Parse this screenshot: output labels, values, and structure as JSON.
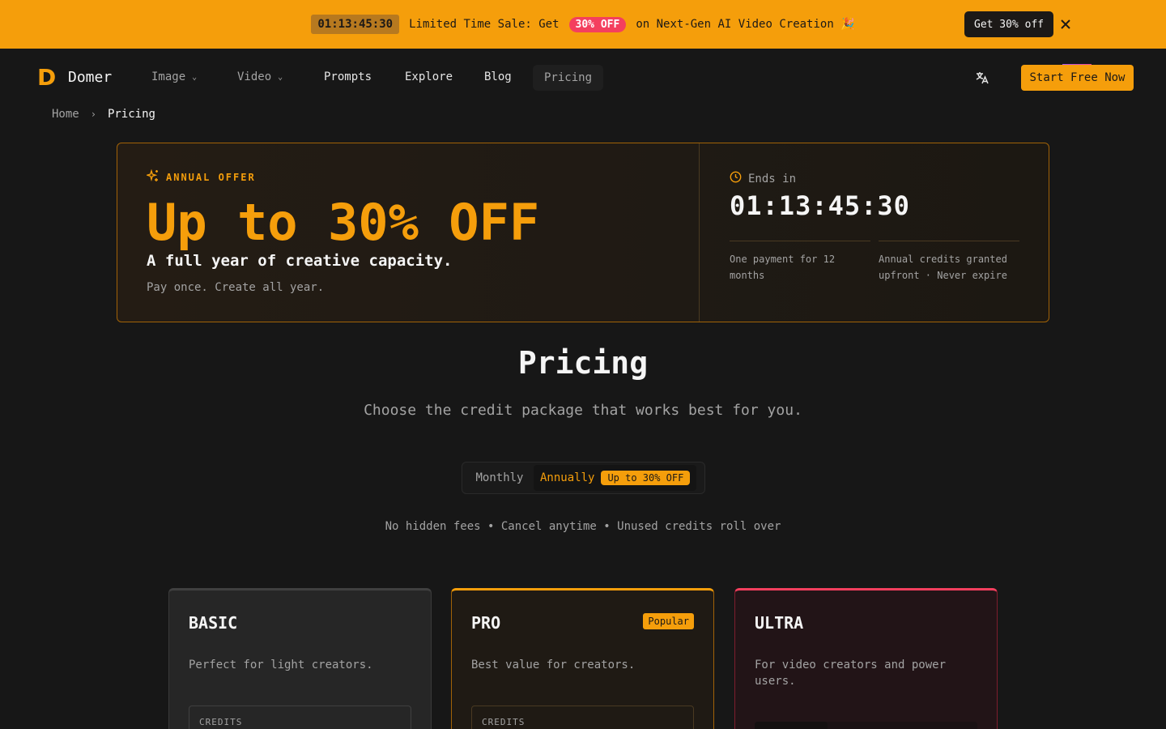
{
  "promo": {
    "timer": "01:13:45:30",
    "text_before": "Limited Time Sale: Get",
    "pill": "30% OFF",
    "text_after": "on Next-Gen AI Video Creation 🎉",
    "cta": "Get 30% off",
    "close_icon": "close-icon",
    "colors": {
      "background": "#f59e0b",
      "pill": "#f43f5e"
    }
  },
  "nav": {
    "logo_letter": "D",
    "brand": "Domer",
    "items": [
      {
        "label": "Image",
        "dropdown": true
      },
      {
        "label": "Video",
        "dropdown": true
      },
      {
        "label": "Prompts"
      },
      {
        "label": "Explore"
      },
      {
        "label": "Blog"
      },
      {
        "label": "Pricing",
        "active": true
      }
    ],
    "translate_icon": "translate-icon",
    "cta": "Start Free Now"
  },
  "breadcrumb": {
    "home": "Home",
    "separator": "›",
    "current": "Pricing"
  },
  "offer": {
    "eyebrow": "ANNUAL OFFER",
    "title": "Up to 30% OFF",
    "subtitle": "A full year of creative capacity.",
    "tagline": "Pay once. Create all year.",
    "ends_label": "Ends in",
    "timer": "01:13:45:30",
    "notes": [
      "One payment for 12 months",
      "Annual credits granted upfront · Never expire"
    ]
  },
  "pricing": {
    "title": "Pricing",
    "subtitle": "Choose the credit package that works best for you.",
    "toggle": {
      "monthly": "Monthly",
      "annually": "Annually",
      "badge": "Up to 30% OFF",
      "selected": "annually"
    },
    "guarantees": "No hidden fees • Cancel anytime • Unused credits roll over"
  },
  "plans": [
    {
      "name": "BASIC",
      "description": "Perfect for light creators.",
      "credits_label": "CREDITS"
    },
    {
      "name": "PRO",
      "badge": "Popular",
      "description": "Best value for creators.",
      "credits_label": "CREDITS"
    },
    {
      "name": "ULTRA",
      "description": "For video creators and power users."
    }
  ],
  "colors": {
    "accent": "#f59e0b",
    "background": "#171717",
    "ultra": "#f43f5e"
  }
}
